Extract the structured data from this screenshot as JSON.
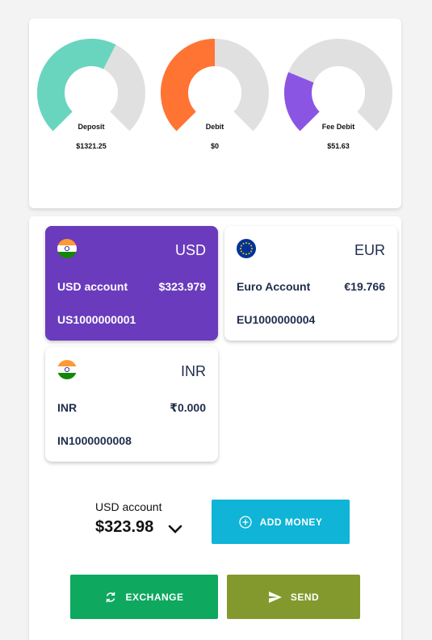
{
  "gauges": [
    {
      "label": "Deposit",
      "value": "$1321.25",
      "color": "#69d5bf",
      "icon": "arrow-up-icon",
      "fill_fraction": 0.6
    },
    {
      "label": "Debit",
      "value": "$0",
      "color": "#ff7433",
      "icon": "arrow-down-icon",
      "fill_fraction": 0.5
    },
    {
      "label": "Fee Debit",
      "value": "$51.63",
      "color": "#8b55e3",
      "icon": "dollar-icon",
      "fill_fraction": 0.25
    }
  ],
  "accounts": [
    {
      "currency": "USD",
      "name": "USD account",
      "balance": "$323.979",
      "number": "US1000000001",
      "flag": "india-flag-icon",
      "active": true
    },
    {
      "currency": "EUR",
      "name": "Euro Account",
      "balance": "€19.766",
      "number": "EU1000000004",
      "flag": "eu-flag-icon",
      "active": false
    },
    {
      "currency": "INR",
      "name": "INR",
      "balance": "₹0.000",
      "number": "IN1000000008",
      "flag": "india-flag-icon",
      "active": false
    }
  ],
  "selected_account": {
    "label": "USD account",
    "balance": "$323.98"
  },
  "buttons": {
    "add_money": "ADD MONEY",
    "exchange": "EXCHANGE",
    "send": "SEND"
  },
  "colors": {
    "active_card": "#6a3bbd",
    "add_money": "#0fb4d6",
    "exchange": "#0ea85f",
    "send": "#84992d",
    "gauge_track": "#e0e0e0"
  }
}
